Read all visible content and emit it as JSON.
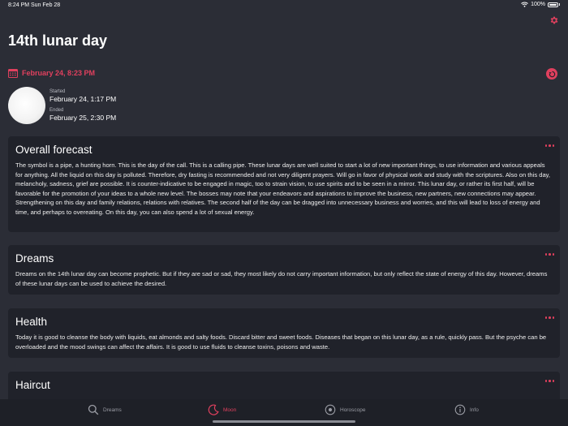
{
  "status_bar": {
    "time": "8:24 PM",
    "date": "Sun Feb 28",
    "battery": "100%"
  },
  "header": {
    "title": "14th lunar day"
  },
  "date_row": {
    "date": "February 24, 8:23 PM"
  },
  "moon_info": {
    "started_label": "Started",
    "started_value": "February 24, 1:17 PM",
    "ended_label": "Ended",
    "ended_value": "February 25, 2:30 PM"
  },
  "cards": [
    {
      "title": "Overall forecast",
      "body": "The symbol is a pipe, a hunting horn. This is the day of the call. This is a calling pipe. These lunar days are well suited to start a lot of new important things, to use information and various appeals for anything. All the liquid on this day is polluted. Therefore, dry fasting is recommended and not very diligent prayers. Will go in favor of physical work and study with the scriptures. Also on this day, melancholy, sadness, grief are possible. It is counter-indicative to be engaged in magic, too to strain vision, to use spirits and to be seen in a mirror. This lunar day, or rather its first half, will be favorable for the promotion of your ideas to a whole new level. The bosses may note that your endeavors and aspirations to improve the business, new partners, new connections may appear. Strengthening on this day and family relations, relations with relatives. The second half of the day can be dragged into unnecessary business and worries, and this will lead to loss of energy and time, and perhaps to overeating. On this day, you can also spend a lot of sexual energy."
    },
    {
      "title": "Dreams",
      "body": "Dreams on the 14th lunar day can become prophetic. But if they are sad or sad, they most likely do not carry important information, but only reflect the state of energy of this day. However, dreams of these lunar days can be used to achieve the desired."
    },
    {
      "title": "Health",
      "body": "Today it is good to cleanse the body with liquids, eat almonds and salty foods. Discard bitter and sweet foods. Diseases that began on this lunar day, as a rule, quickly pass. But the psyche can be overloaded and the mood swings can affect the affairs. It is good to use fluids to cleanse toxins, poisons and waste."
    },
    {
      "title": "Haircut",
      "body": ""
    }
  ],
  "tabs": [
    {
      "label": "Dreams",
      "icon": "search-icon"
    },
    {
      "label": "Moon",
      "icon": "moon-icon"
    },
    {
      "label": "Horoscope",
      "icon": "horoscope-icon"
    },
    {
      "label": "Info",
      "icon": "info-icon"
    }
  ],
  "colors": {
    "accent": "#e0405e",
    "background": "#2b2d36",
    "card": "#20222a"
  }
}
